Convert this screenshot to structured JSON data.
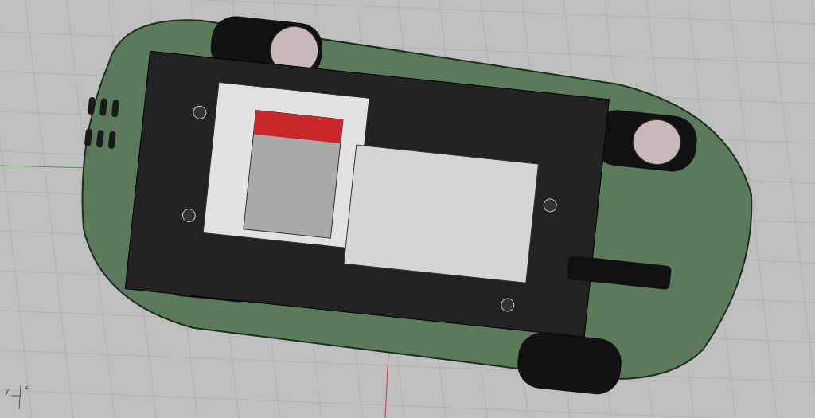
{
  "viewport": {
    "axis_labels": [
      {
        "text": "y",
        "kind": "y"
      },
      {
        "text": "z",
        "kind": "z"
      }
    ]
  }
}
